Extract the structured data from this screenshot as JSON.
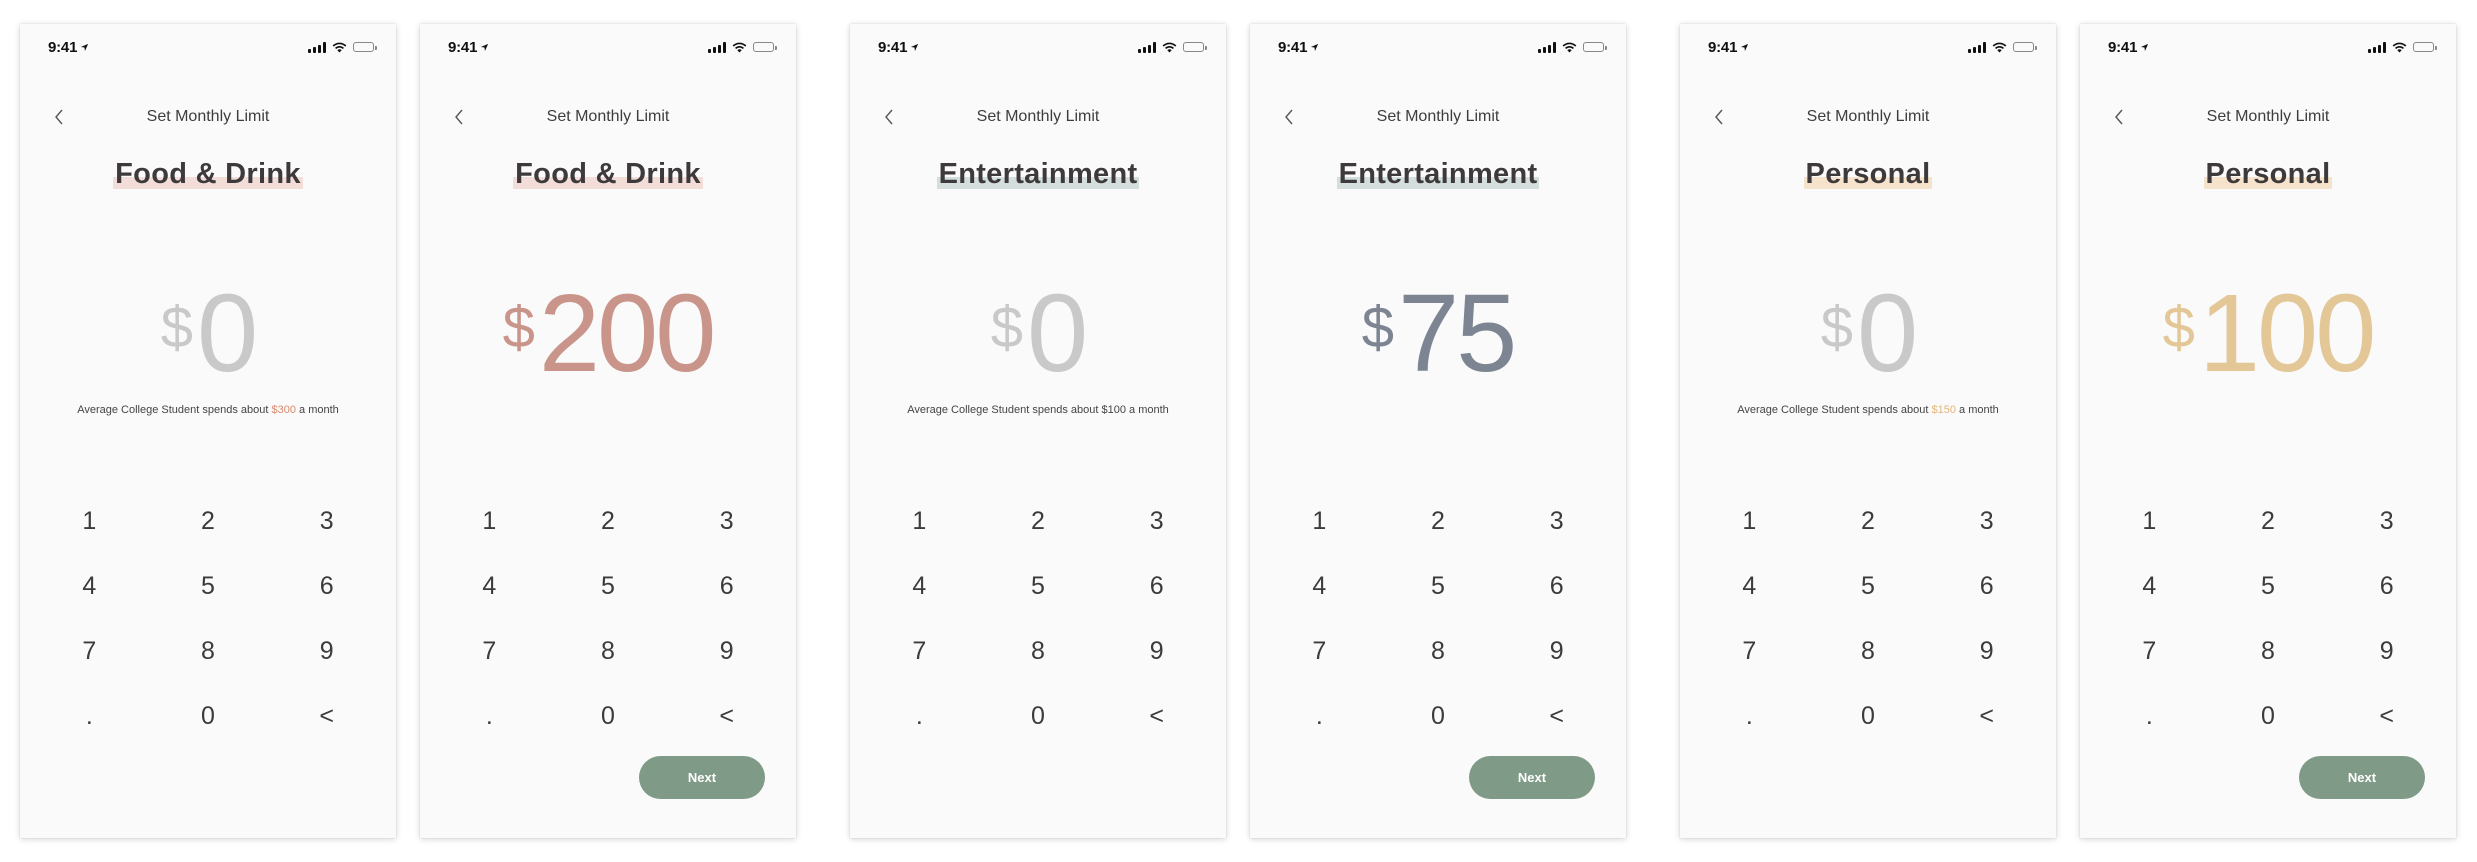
{
  "status": {
    "time": "9:41"
  },
  "nav": {
    "title": "Set Monthly Limit"
  },
  "keypad": [
    "1",
    "2",
    "3",
    "4",
    "5",
    "6",
    "7",
    "8",
    "9",
    ".",
    "0",
    "<"
  ],
  "next_label": "Next",
  "hint": {
    "prefix": "Average College Student spends about",
    "suffix": "a month"
  },
  "currency_symbol": "$",
  "colors": {
    "next_button": "#7f9a87",
    "placeholder_amount": "#c9c9c9",
    "food": "#c9948a",
    "food_highlight": "#f2ddd8",
    "entertainment": "#7c8591",
    "entertainment_highlight": "#d3dedd",
    "personal": "#e3c797",
    "personal_highlight": "#f6e3cc"
  },
  "screens": [
    {
      "category": "Food & Drink",
      "amount": "0",
      "state": "empty",
      "hint_amount": "$300",
      "hint_color": "#d98a6c"
    },
    {
      "category": "Food & Drink",
      "amount": "200",
      "state": "filled"
    },
    {
      "category": "Entertainment",
      "amount": "0",
      "state": "empty",
      "hint_amount": "$100",
      "hint_color": "#444444"
    },
    {
      "category": "Entertainment",
      "amount": "75",
      "state": "filled"
    },
    {
      "category": "Personal",
      "amount": "0",
      "state": "empty",
      "hint_amount": "$150",
      "hint_color": "#e3b67a"
    },
    {
      "category": "Personal",
      "amount": "100",
      "state": "filled"
    }
  ]
}
